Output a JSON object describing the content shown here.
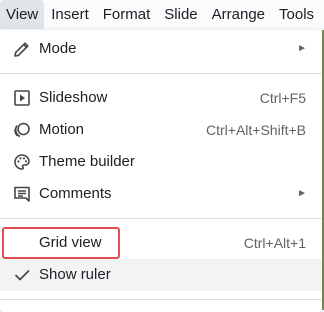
{
  "menubar": {
    "items": [
      {
        "label": "View",
        "active": true
      },
      {
        "label": "Insert",
        "active": false
      },
      {
        "label": "Format",
        "active": false
      },
      {
        "label": "Slide",
        "active": false
      },
      {
        "label": "Arrange",
        "active": false
      },
      {
        "label": "Tools",
        "active": false
      }
    ]
  },
  "menu": {
    "mode": {
      "label": "Mode",
      "icon": "pencil-icon",
      "submenu_arrow": "►"
    },
    "slideshow": {
      "label": "Slideshow",
      "shortcut": "Ctrl+F5",
      "icon": "play-box-icon"
    },
    "motion": {
      "label": "Motion",
      "shortcut": "Ctrl+Alt+Shift+B",
      "icon": "motion-icon"
    },
    "theme_builder": {
      "label": "Theme builder",
      "icon": "palette-icon"
    },
    "comments": {
      "label": "Comments",
      "icon": "comment-icon",
      "submenu_arrow": "►"
    },
    "grid_view": {
      "label": "Grid view",
      "shortcut": "Ctrl+Alt+1"
    },
    "show_ruler": {
      "label": "Show ruler",
      "icon": "checkmark-icon",
      "checked": true,
      "highlighted": true
    }
  },
  "colors": {
    "highlight_border": "#e04f4f",
    "menubar_bg": "#f9fbfd",
    "active_tab_bg": "#e1e5ea"
  }
}
